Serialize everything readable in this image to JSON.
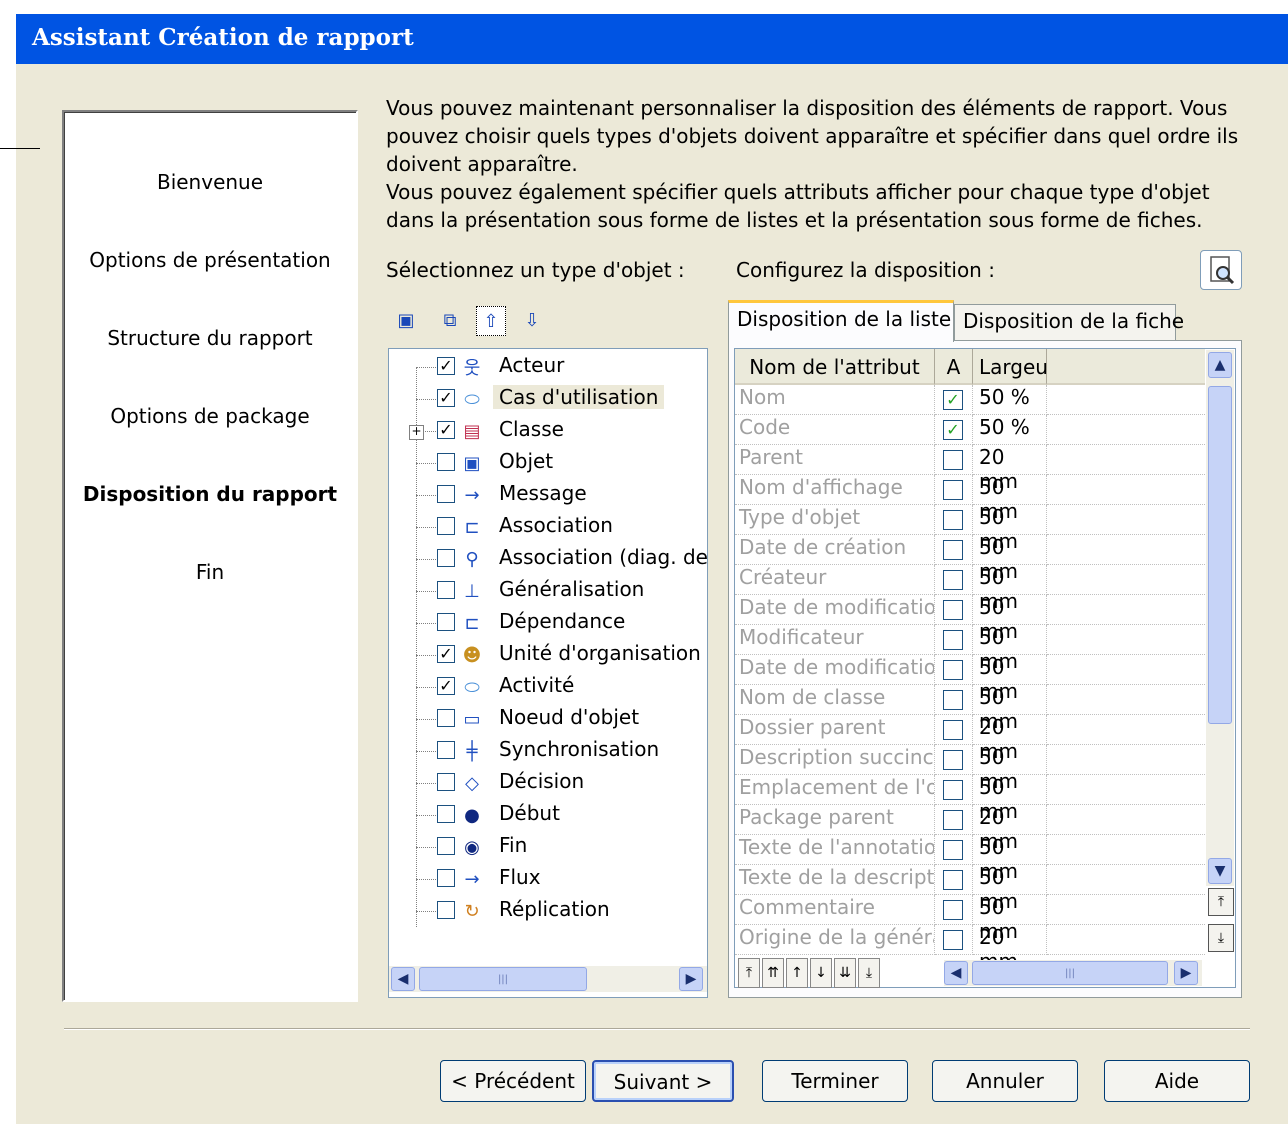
{
  "window": {
    "title": "Assistant Création de rapport"
  },
  "steps": [
    {
      "label": "Bienvenue",
      "current": false
    },
    {
      "label": "Options de présentation",
      "current": false
    },
    {
      "label": "Structure du rapport",
      "current": false
    },
    {
      "label": "Options de package",
      "current": false
    },
    {
      "label": "Disposition du rapport",
      "current": true
    },
    {
      "label": "Fin",
      "current": false
    }
  ],
  "intro": {
    "line1": "Vous pouvez maintenant personnaliser la disposition des éléments de rapport. Vous pouvez choisir quels types d'objets doivent apparaître et spécifier dans quel ordre ils doivent apparaître.",
    "line2": "Vous pouvez également spécifier quels attributs afficher pour chaque type d'objet dans la présentation sous forme de listes et la présentation sous forme de fiches."
  },
  "labels": {
    "select_type": "Sélectionnez un type d'objet :",
    "configure": "Configurez la disposition :"
  },
  "object_types": [
    {
      "label": "Acteur",
      "checked": true,
      "icon": "actor-icon",
      "glyph": "웃",
      "color": "#2050c0"
    },
    {
      "label": "Cas d'utilisation",
      "checked": true,
      "icon": "use-case-icon",
      "glyph": "⬭",
      "color": "#4a90d8",
      "selected": true
    },
    {
      "label": "Classe",
      "checked": true,
      "icon": "class-icon",
      "glyph": "▤",
      "color": "#c03050",
      "expandable": true
    },
    {
      "label": "Objet",
      "checked": false,
      "icon": "object-icon",
      "glyph": "▣",
      "color": "#2050c0"
    },
    {
      "label": "Message",
      "checked": false,
      "icon": "message-icon",
      "glyph": "→",
      "color": "#2050c0"
    },
    {
      "label": "Association",
      "checked": false,
      "icon": "association-icon",
      "glyph": "⊏",
      "color": "#2050c0"
    },
    {
      "label": "Association (diag. de d",
      "checked": false,
      "icon": "association-diagram-icon",
      "glyph": "⚲",
      "color": "#2050c0"
    },
    {
      "label": "Généralisation",
      "checked": false,
      "icon": "generalization-icon",
      "glyph": "⊥",
      "color": "#2050c0"
    },
    {
      "label": "Dépendance",
      "checked": false,
      "icon": "dependency-icon",
      "glyph": "⊏",
      "color": "#2050c0"
    },
    {
      "label": "Unité d'organisation",
      "checked": true,
      "icon": "organization-unit-icon",
      "glyph": "☻",
      "color": "#c89020"
    },
    {
      "label": "Activité",
      "checked": true,
      "icon": "activity-icon",
      "glyph": "⬭",
      "color": "#4a90d8"
    },
    {
      "label": "Noeud d'objet",
      "checked": false,
      "icon": "object-node-icon",
      "glyph": "▭",
      "color": "#2050c0"
    },
    {
      "label": "Synchronisation",
      "checked": false,
      "icon": "synchronization-icon",
      "glyph": "╪",
      "color": "#2050c0"
    },
    {
      "label": "Décision",
      "checked": false,
      "icon": "decision-icon",
      "glyph": "◇",
      "color": "#2050c0"
    },
    {
      "label": "Début",
      "checked": false,
      "icon": "start-icon",
      "glyph": "●",
      "color": "#102880"
    },
    {
      "label": "Fin",
      "checked": false,
      "icon": "end-icon",
      "glyph": "◉",
      "color": "#102880"
    },
    {
      "label": "Flux",
      "checked": false,
      "icon": "flow-icon",
      "glyph": "→",
      "color": "#2050c0"
    },
    {
      "label": "Réplication",
      "checked": false,
      "icon": "replication-icon",
      "glyph": "↻",
      "color": "#d08020"
    }
  ],
  "tabs": [
    {
      "label": "Disposition de la liste",
      "active": true
    },
    {
      "label": "Disposition de la fiche",
      "active": false
    }
  ],
  "grid": {
    "headers": [
      "Nom de l'attribut",
      "A",
      "Largeu"
    ],
    "rows": [
      {
        "name": "Nom",
        "checked": true,
        "width": "50 %"
      },
      {
        "name": "Code",
        "checked": true,
        "width": "50 %"
      },
      {
        "name": "Parent",
        "checked": false,
        "width": "20 mm"
      },
      {
        "name": "Nom d'affichage",
        "checked": false,
        "width": "50 mm"
      },
      {
        "name": "Type d'objet",
        "checked": false,
        "width": "50 mm"
      },
      {
        "name": "Date de création",
        "checked": false,
        "width": "50 mm"
      },
      {
        "name": "Créateur",
        "checked": false,
        "width": "50 mm"
      },
      {
        "name": "Date de modificatior",
        "checked": false,
        "width": "50 mm"
      },
      {
        "name": "Modificateur",
        "checked": false,
        "width": "50 mm"
      },
      {
        "name": "Date de modificatior",
        "checked": false,
        "width": "50 mm"
      },
      {
        "name": "Nom de classe",
        "checked": false,
        "width": "50 mm"
      },
      {
        "name": "Dossier parent",
        "checked": false,
        "width": "20 mm"
      },
      {
        "name": "Description succinct",
        "checked": false,
        "width": "50 mm"
      },
      {
        "name": "Emplacement de l'o",
        "checked": false,
        "width": "50 mm"
      },
      {
        "name": "Package parent",
        "checked": false,
        "width": "20 mm"
      },
      {
        "name": "Texte de l'annotatio",
        "checked": false,
        "width": "50 mm"
      },
      {
        "name": "Texte de la descripti",
        "checked": false,
        "width": "50 mm"
      },
      {
        "name": "Commentaire",
        "checked": false,
        "width": "50 mm"
      },
      {
        "name": "Origine de la généra",
        "checked": false,
        "width": "20 mm"
      }
    ]
  },
  "buttons": {
    "previous": "< Précédent",
    "next": "Suivant >",
    "finish": "Terminer",
    "cancel": "Annuler",
    "help": "Aide"
  }
}
